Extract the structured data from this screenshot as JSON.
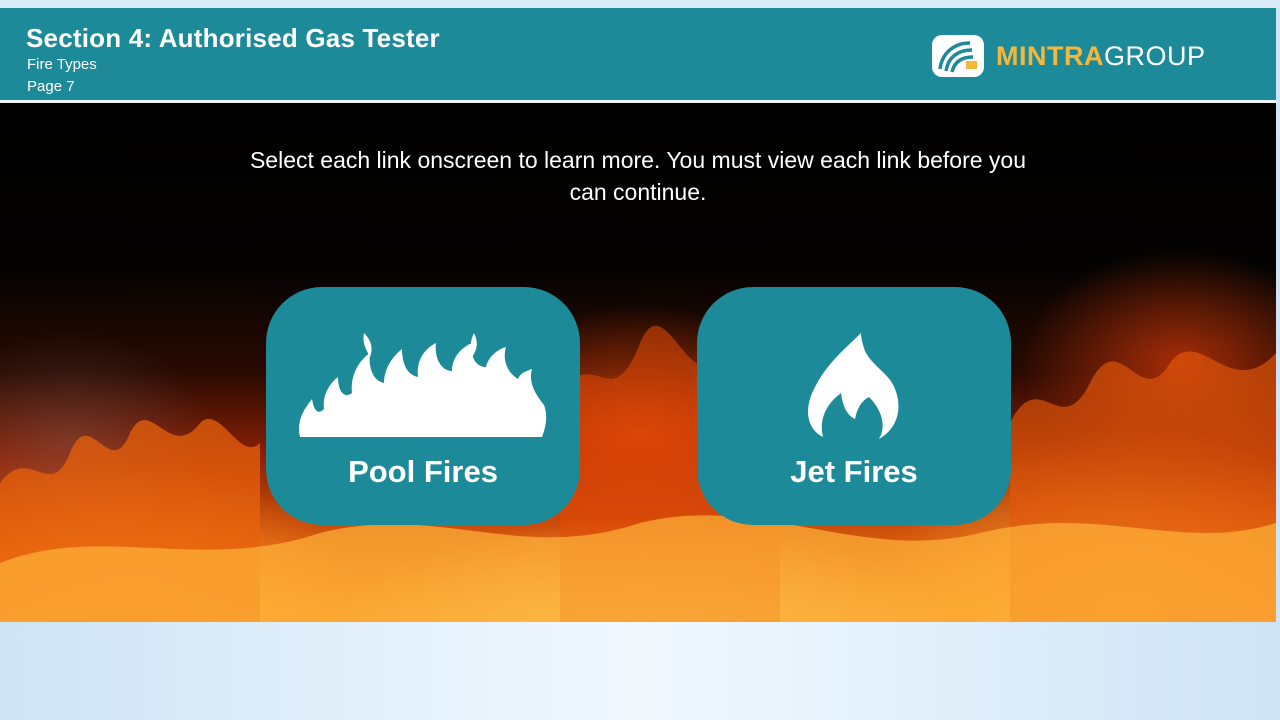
{
  "header": {
    "title": "Section 4: Authorised Gas Tester",
    "subtitle": "Fire Types",
    "page": "Page 7"
  },
  "logo": {
    "part1": "MINTRA",
    "part2": "GROUP",
    "colors": {
      "accent": "#f4b73b",
      "text": "#ffffff"
    }
  },
  "instruction": "Select each link onscreen to learn more. You must view each link before you can continue.",
  "links": [
    {
      "label": "Pool Fires",
      "icon": "pool-fire-icon"
    },
    {
      "label": "Jet Fires",
      "icon": "jet-fire-icon"
    }
  ],
  "colors": {
    "teal": "#1d8a99",
    "white": "#ffffff"
  }
}
